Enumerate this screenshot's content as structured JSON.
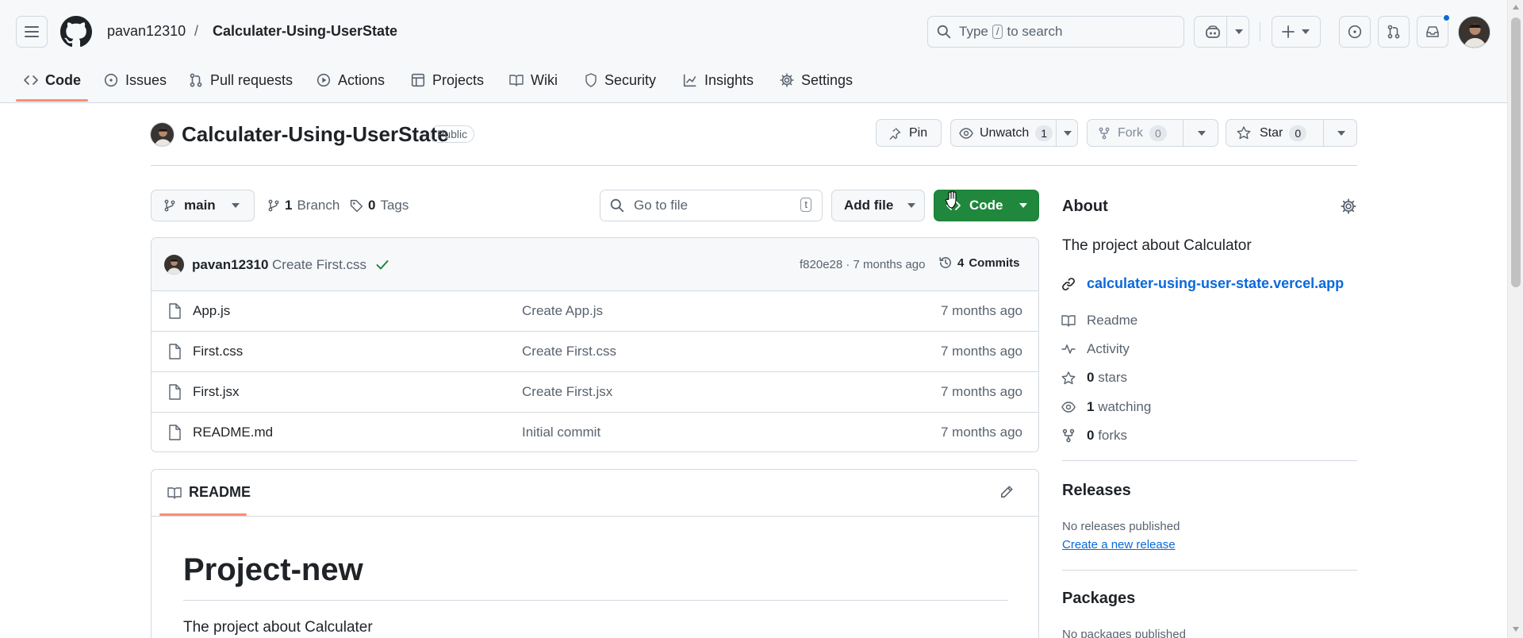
{
  "header": {
    "owner": "pavan12310",
    "separator": "/",
    "repo": "Calculater-Using-UserState",
    "search_pre": "Type",
    "search_key": "/",
    "search_post": "to search"
  },
  "nav": {
    "tabs": [
      {
        "label": "Code"
      },
      {
        "label": "Issues"
      },
      {
        "label": "Pull requests"
      },
      {
        "label": "Actions"
      },
      {
        "label": "Projects"
      },
      {
        "label": "Wiki"
      },
      {
        "label": "Security"
      },
      {
        "label": "Insights"
      },
      {
        "label": "Settings"
      }
    ]
  },
  "repo_head": {
    "title": "Calculater-Using-UserState",
    "visibility": "Public",
    "pin_label": "Pin",
    "watch_label": "Unwatch",
    "watch_count": "1",
    "fork_label": "Fork",
    "fork_count": "0",
    "star_label": "Star",
    "star_count": "0"
  },
  "toolbar": {
    "branch": "main",
    "branch_count": "1",
    "branch_label": "Branch",
    "tag_count": "0",
    "tag_label": "Tags",
    "goto_placeholder": "Go to file",
    "goto_key": "t",
    "add_file_label": "Add file",
    "code_label": "Code"
  },
  "latest_commit": {
    "author": "pavan12310",
    "message": "Create First.css",
    "hash_time": "f820e28 · 7 months ago",
    "commits_count": "4",
    "commits_label": "Commits"
  },
  "files": [
    {
      "name": "App.js",
      "message": "Create App.js",
      "date": "7 months ago"
    },
    {
      "name": "First.css",
      "message": "Create First.css",
      "date": "7 months ago"
    },
    {
      "name": "First.jsx",
      "message": "Create First.jsx",
      "date": "7 months ago"
    },
    {
      "name": "README.md",
      "message": "Initial commit",
      "date": "7 months ago"
    }
  ],
  "readme": {
    "tab_label": "README",
    "heading": "Project-new",
    "body": "The project about Calculater"
  },
  "about": {
    "title": "About",
    "description": "The project about Calculator",
    "website": "calculater-using-user-state.vercel.app",
    "readme": "Readme",
    "activity": "Activity",
    "stars_count": "0",
    "stars_label": "stars",
    "watching_count": "1",
    "watching_label": "watching",
    "forks_count": "0",
    "forks_label": "forks"
  },
  "releases": {
    "title": "Releases",
    "empty": "No releases published",
    "create_link": "Create a new release"
  },
  "packages": {
    "title": "Packages",
    "empty": "No packages published"
  },
  "colors": {
    "accent_green": "#1f883d",
    "link_blue": "#0969da",
    "underline_orange": "#fd8c73",
    "notification_blue": "#0969da"
  }
}
